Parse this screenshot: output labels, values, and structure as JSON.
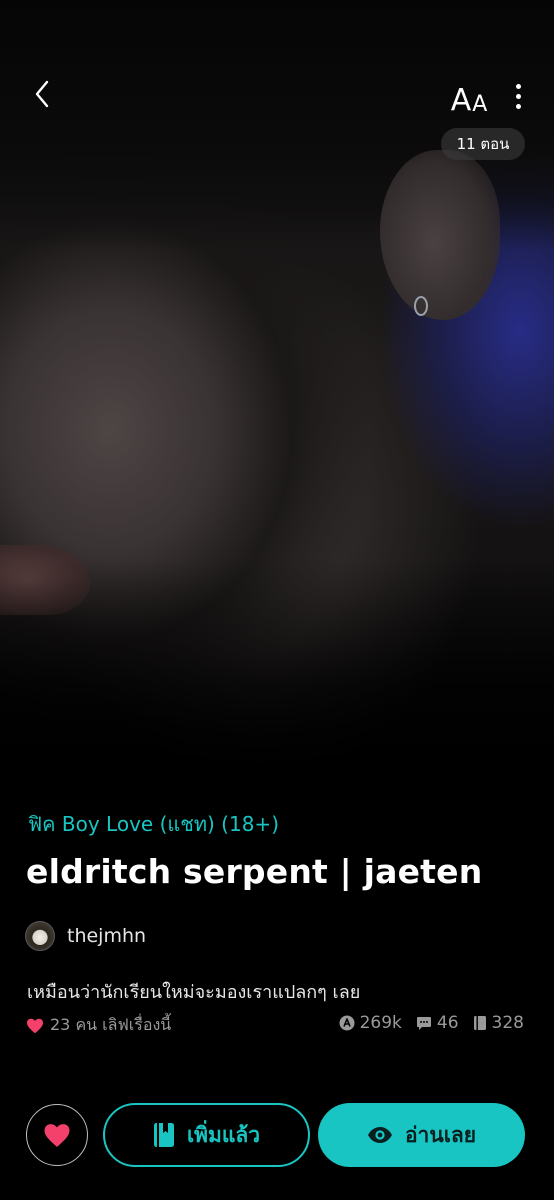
{
  "header": {
    "font_size_label_big": "A",
    "font_size_label_small": "A",
    "episode_count": "11 ตอน"
  },
  "story": {
    "category": "ฟิค Boy Love (แชท) (18+)",
    "title": "eldritch serpent | jaeten",
    "author": "thejmhn",
    "description": "เหมือนว่านักเรียนใหม่จะมองเราแปลกๆ เลย",
    "likes_text": "23 คน เลิฟเรื่องนี้",
    "views": "269k",
    "comments": "46",
    "chapters": "328"
  },
  "actions": {
    "added_label": "เพิ่มแล้ว",
    "read_label": "อ่านเลย"
  },
  "colors": {
    "accent": "#19c5c2",
    "heart": "#f4416c",
    "muted": "#9a9a9a"
  },
  "icons": {
    "back": "chevron-left-icon",
    "font_size": "font-size-icon",
    "more": "more-vertical-icon",
    "like": "heart-icon",
    "views": "views-icon",
    "comments": "comment-icon",
    "chapters": "book-icon",
    "added": "bookmark-book-icon",
    "read": "eye-icon"
  }
}
